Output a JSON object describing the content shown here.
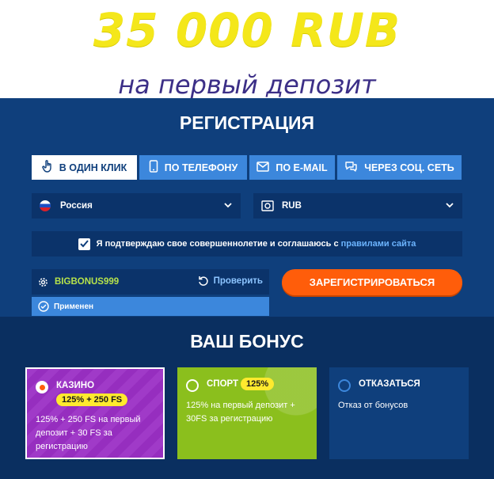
{
  "hero": {
    "amount": "35 000 RUB",
    "subtitle": "на первый депозит"
  },
  "registration": {
    "title": "РЕГИСТРАЦИЯ",
    "tabs": [
      {
        "label": "В ОДИН КЛИК",
        "icon": "hand-pointer-icon",
        "active": true
      },
      {
        "label": "ПО ТЕЛЕФОНУ",
        "icon": "phone-icon",
        "active": false
      },
      {
        "label": "ПО E-MAIL",
        "icon": "mail-icon",
        "active": false
      },
      {
        "label": "ЧЕРЕЗ СОЦ. СЕТЬ",
        "icon": "chat-icon",
        "active": false
      }
    ],
    "country": {
      "value": "Россия",
      "icon": "russia-flag-icon"
    },
    "currency": {
      "value": "RUB",
      "icon": "currency-icon"
    },
    "agreement": {
      "text": "Я подтверждаю свое совершеннолетие и соглашаюсь с",
      "link": "правилами сайта",
      "checked": true
    },
    "promo": {
      "code": "BIGBONUS999",
      "check_label": "Проверить",
      "status": "Применен"
    },
    "submit_label": "ЗАРЕГИСТРИРОВАТЬСЯ"
  },
  "bonus": {
    "title": "ВАШ БОНУС",
    "cards": [
      {
        "title": "КАЗИНО",
        "badge": "125% + 250 FS",
        "desc": "125% + 250 FS на первый депозит + 30 FS за регистрацию",
        "selected": true
      },
      {
        "title": "СПОРТ",
        "badge": "125%",
        "desc": "125% на первый депозит + 30FS за регистрацию",
        "selected": false
      },
      {
        "title": "ОТКАЗАТЬСЯ",
        "badge": "",
        "desc": "Отказ от бонусов",
        "selected": false
      }
    ]
  },
  "colors": {
    "panel": "#0f3f7c",
    "tab": "#3c87dc",
    "accent": "#ff5d0a",
    "amount": "#f4e71a",
    "subtitle": "#3c2f87"
  }
}
